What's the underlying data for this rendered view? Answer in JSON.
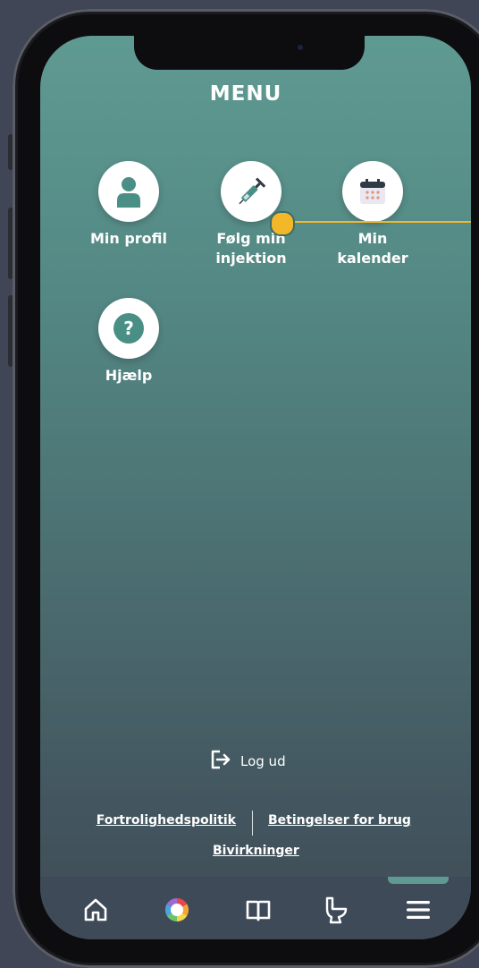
{
  "header": {
    "title": "MENU"
  },
  "menu": {
    "items": [
      {
        "label": "Min profil",
        "icon": "person-icon"
      },
      {
        "label": "Følg min\ninjektion",
        "icon": "syringe-icon"
      },
      {
        "label": "Min\nkalender",
        "icon": "calendar-icon"
      },
      {
        "label": "Hjælp",
        "icon": "question-icon"
      }
    ]
  },
  "logout": {
    "label": "Log ud",
    "icon": "logout-icon"
  },
  "footer": {
    "privacy": "Fortrolighedspolitik",
    "terms": "Betingelser for brug",
    "side_effects": "Bivirkninger"
  },
  "tabbar": {
    "tabs": [
      {
        "icon": "home-icon"
      },
      {
        "icon": "color-wheel-icon"
      },
      {
        "icon": "book-icon"
      },
      {
        "icon": "toilet-icon"
      },
      {
        "icon": "hamburger-menu-icon",
        "active": true
      }
    ]
  },
  "colors": {
    "accent": "#5f9a92",
    "marker": "#f2b82a",
    "icon_teal": "#4a8f86"
  }
}
